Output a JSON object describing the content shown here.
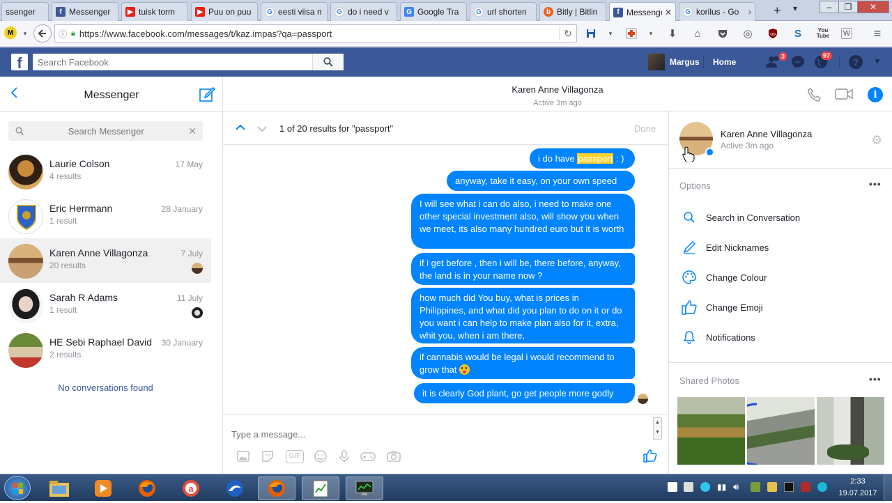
{
  "browser": {
    "tabs": [
      {
        "title": "ssenger",
        "icon": "facebook-icon"
      },
      {
        "title": "Messenger",
        "icon": "facebook-icon"
      },
      {
        "title": "tuisk torm",
        "icon": "youtube-icon"
      },
      {
        "title": "Puu on puu",
        "icon": "youtube-icon"
      },
      {
        "title": "eesti viisa n",
        "icon": "google-icon"
      },
      {
        "title": "do i need v",
        "icon": "google-icon"
      },
      {
        "title": "Google Tra",
        "icon": "google-translate-icon"
      },
      {
        "title": "url shorten",
        "icon": "google-icon"
      },
      {
        "title": "Bitly | Bitlin",
        "icon": "bitly-icon"
      },
      {
        "title": "Messenger",
        "icon": "facebook-icon"
      },
      {
        "title": "korilus - Go",
        "icon": "google-icon"
      }
    ],
    "url": "https://www.facebook.com/messages/t/kaz.impas?qa=passport",
    "url_domain": "facebook.com"
  },
  "fb": {
    "search_placeholder": "Search Facebook",
    "profile_name": "Margus",
    "home_label": "Home",
    "friend_badge": "3",
    "notif_badge": "97"
  },
  "left": {
    "title": "Messenger",
    "search_placeholder": "Search Messenger",
    "conversations": [
      {
        "name": "Laurie Colson",
        "results": "4 results",
        "date": "17 May"
      },
      {
        "name": "Eric Herrmann",
        "results": "1 result",
        "date": "28 January"
      },
      {
        "name": "Karen Anne Villagonza",
        "results": "20 results",
        "date": "7 July"
      },
      {
        "name": "Sarah R Adams",
        "results": "1 result",
        "date": "11 July"
      },
      {
        "name": "HE Sebi Raphael David",
        "results": "2 results",
        "date": "30 January"
      }
    ],
    "no_conversations": "No conversations found"
  },
  "header": {
    "name": "Karen Anne Villagonza",
    "status": "Active 3m ago"
  },
  "searchbar": {
    "count": "1 of 20 results for \"passport\"",
    "done": "Done"
  },
  "messages": {
    "m1_pre": "i do have ",
    "m1_hl": "passport",
    "m1_post": " : )",
    "m2": "anyway, take it easy, on your own speed",
    "m3": "I will see what i can do also, i need to make one other special investment also, will show you when we meet, its also many hundred euro but it is worth",
    "m4": "if i get before , then i will be, there before, anyway, the land is in your name now ?",
    "m5": "how much did You buy, what is prices in Philippines, and what did you plan to do on it or do you want i can help to make plan also for it, extra, whit you,  when i am there,",
    "m6": "if cannabis would be legal i would recommend to grow that",
    "m7": "it is clearly God plant, go get people more godly"
  },
  "composer": {
    "placeholder": "Type a message..."
  },
  "right": {
    "name": "Karen Anne Villagonza",
    "status": "Active 3m ago",
    "options_title": "Options",
    "options": [
      {
        "label": "Search in Conversation",
        "icon": "search-icon"
      },
      {
        "label": "Edit Nicknames",
        "icon": "pencil-icon"
      },
      {
        "label": "Change Colour",
        "icon": "palette-icon"
      },
      {
        "label": "Change Emoji",
        "icon": "thumbs-up-icon"
      },
      {
        "label": "Notifications",
        "icon": "bell-icon"
      }
    ],
    "shared_photos_title": "Shared Photos"
  },
  "taskbar": {
    "time": "2:33",
    "date": "19.07.2017"
  },
  "colors": {
    "messenger_blue": "#0084ff",
    "facebook_blue": "#3b5998",
    "highlight": "#f7d22d"
  }
}
